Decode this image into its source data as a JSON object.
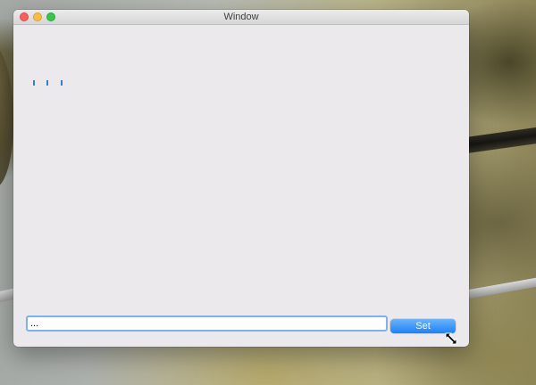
{
  "window": {
    "title": "Window"
  },
  "ticks": {
    "count": 3,
    "color": "#2d7fe0"
  },
  "input": {
    "value": "..."
  },
  "button": {
    "set_label": "Set"
  },
  "colors": {
    "accent": "#1a82fb",
    "focus_ring": "#7fb1ef",
    "window_bg": "#ebe9ec"
  },
  "icons": [
    "close-window-icon",
    "minimize-window-icon",
    "zoom-window-icon",
    "diagonal-resize-cursor-icon"
  ]
}
